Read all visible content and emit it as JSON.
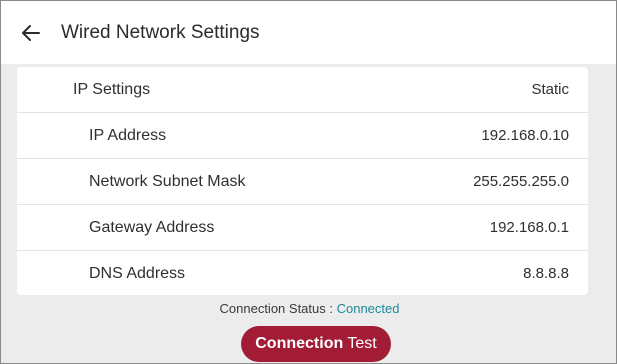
{
  "header": {
    "back_icon": "arrow-left-icon",
    "title": "Wired Network Settings"
  },
  "ip_settings": {
    "label": "IP Settings",
    "value": "Static"
  },
  "rows": [
    {
      "label": "IP Address",
      "value": "192.168.0.10"
    },
    {
      "label": "Network Subnet Mask",
      "value": "255.255.255.0"
    },
    {
      "label": "Gateway Address",
      "value": "192.168.0.1"
    },
    {
      "label": "DNS Address",
      "value": "8.8.8.8"
    }
  ],
  "status": {
    "label": "Connection Status : ",
    "value": "Connected",
    "value_color": "#1a8a9a"
  },
  "test_button": {
    "label_bold": "Connection",
    "label_rest": " Test",
    "color": "#a31c36"
  }
}
